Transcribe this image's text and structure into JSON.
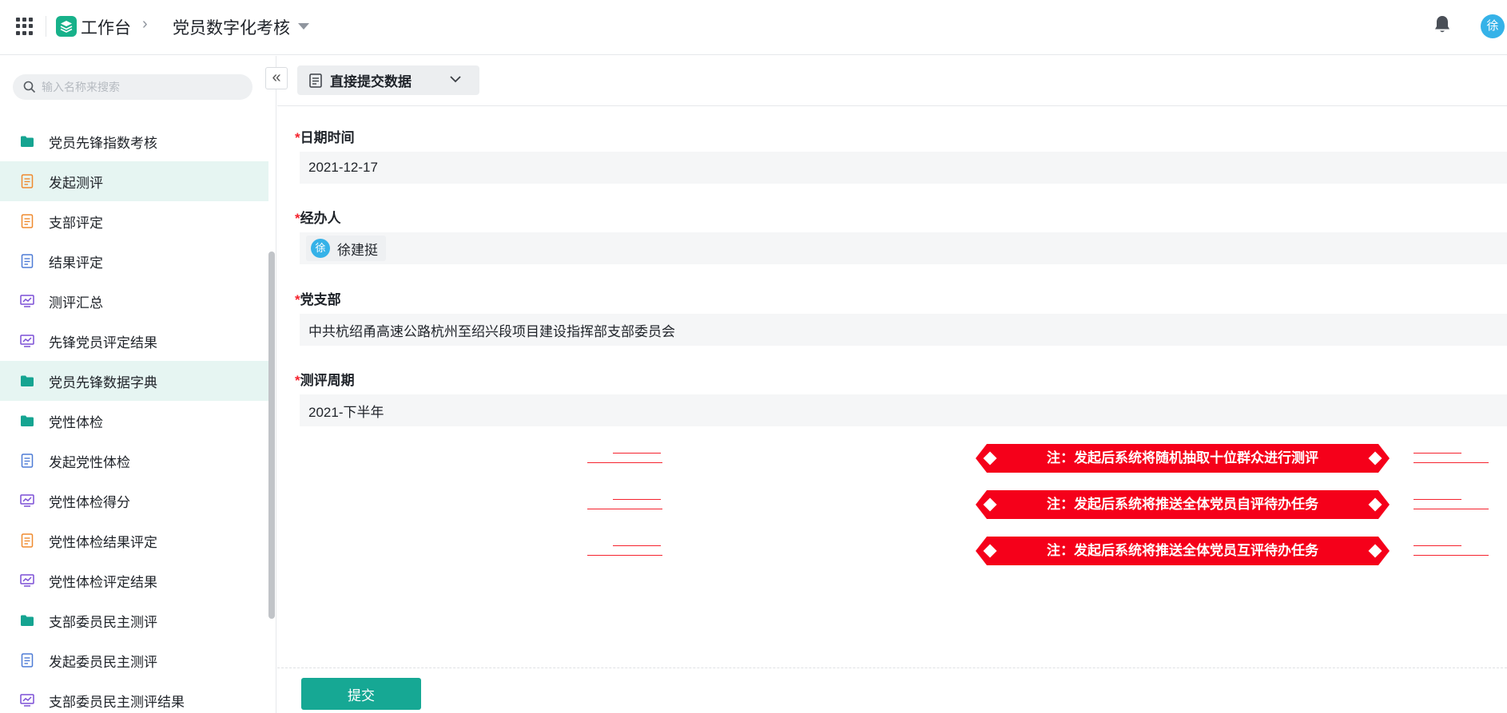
{
  "topbar": {
    "workspace": "工作台",
    "app_name": "党员数字化考核",
    "avatar_text": "徐"
  },
  "sidebar": {
    "search_placeholder": "输入名称来搜索",
    "items": [
      {
        "label": "党员先锋指数考核",
        "icon": "folder-icon",
        "active": false
      },
      {
        "label": "发起测评",
        "icon": "form-icon",
        "active": true
      },
      {
        "label": "支部评定",
        "icon": "form-icon",
        "active": false
      },
      {
        "label": "结果评定",
        "icon": "form-icon",
        "active": false
      },
      {
        "label": "测评汇总",
        "icon": "report-icon",
        "active": false
      },
      {
        "label": "先锋党员评定结果",
        "icon": "report-icon",
        "active": false
      },
      {
        "label": "党员先锋数据字典",
        "icon": "folder-icon",
        "active": true
      },
      {
        "label": "党性体检",
        "icon": "folder-icon",
        "active": false
      },
      {
        "label": "发起党性体检",
        "icon": "form-icon",
        "active": false
      },
      {
        "label": "党性体检得分",
        "icon": "report-icon",
        "active": false
      },
      {
        "label": "党性体检结果评定",
        "icon": "form-icon",
        "active": false
      },
      {
        "label": "党性体检评定结果",
        "icon": "report-icon",
        "active": false
      },
      {
        "label": "支部委员民主测评",
        "icon": "folder-icon",
        "active": false
      },
      {
        "label": "发起委员民主测评",
        "icon": "form-icon",
        "active": false
      },
      {
        "label": "支部委员民主测评结果",
        "icon": "report-icon",
        "active": false
      }
    ]
  },
  "toolbar": {
    "data_view": "直接提交数据"
  },
  "form": {
    "date_label": "日期时间",
    "date_value": "2021-12-17",
    "handler_label": "经办人",
    "handler_avatar": "徐",
    "handler_name": "徐建挺",
    "branch_label": "党支部",
    "branch_value": "中共杭绍甬高速公路杭州至绍兴段项目建设指挥部支部委员会",
    "period_label": "测评周期",
    "period_value": "2021-下半年",
    "required_mark": "*"
  },
  "notices": [
    "注：发起后系统将随机抽取十位群众进行测评",
    "注：发起后系统将推送全体党员自评待办任务",
    "注：发起后系统将推送全体党员互评待办任务"
  ],
  "footer": {
    "submit_label": "提交"
  },
  "colors": {
    "accent": "#16a894",
    "notice_red": "#f5001a",
    "required": "#f5222d",
    "avatar": "#35b2e8"
  }
}
